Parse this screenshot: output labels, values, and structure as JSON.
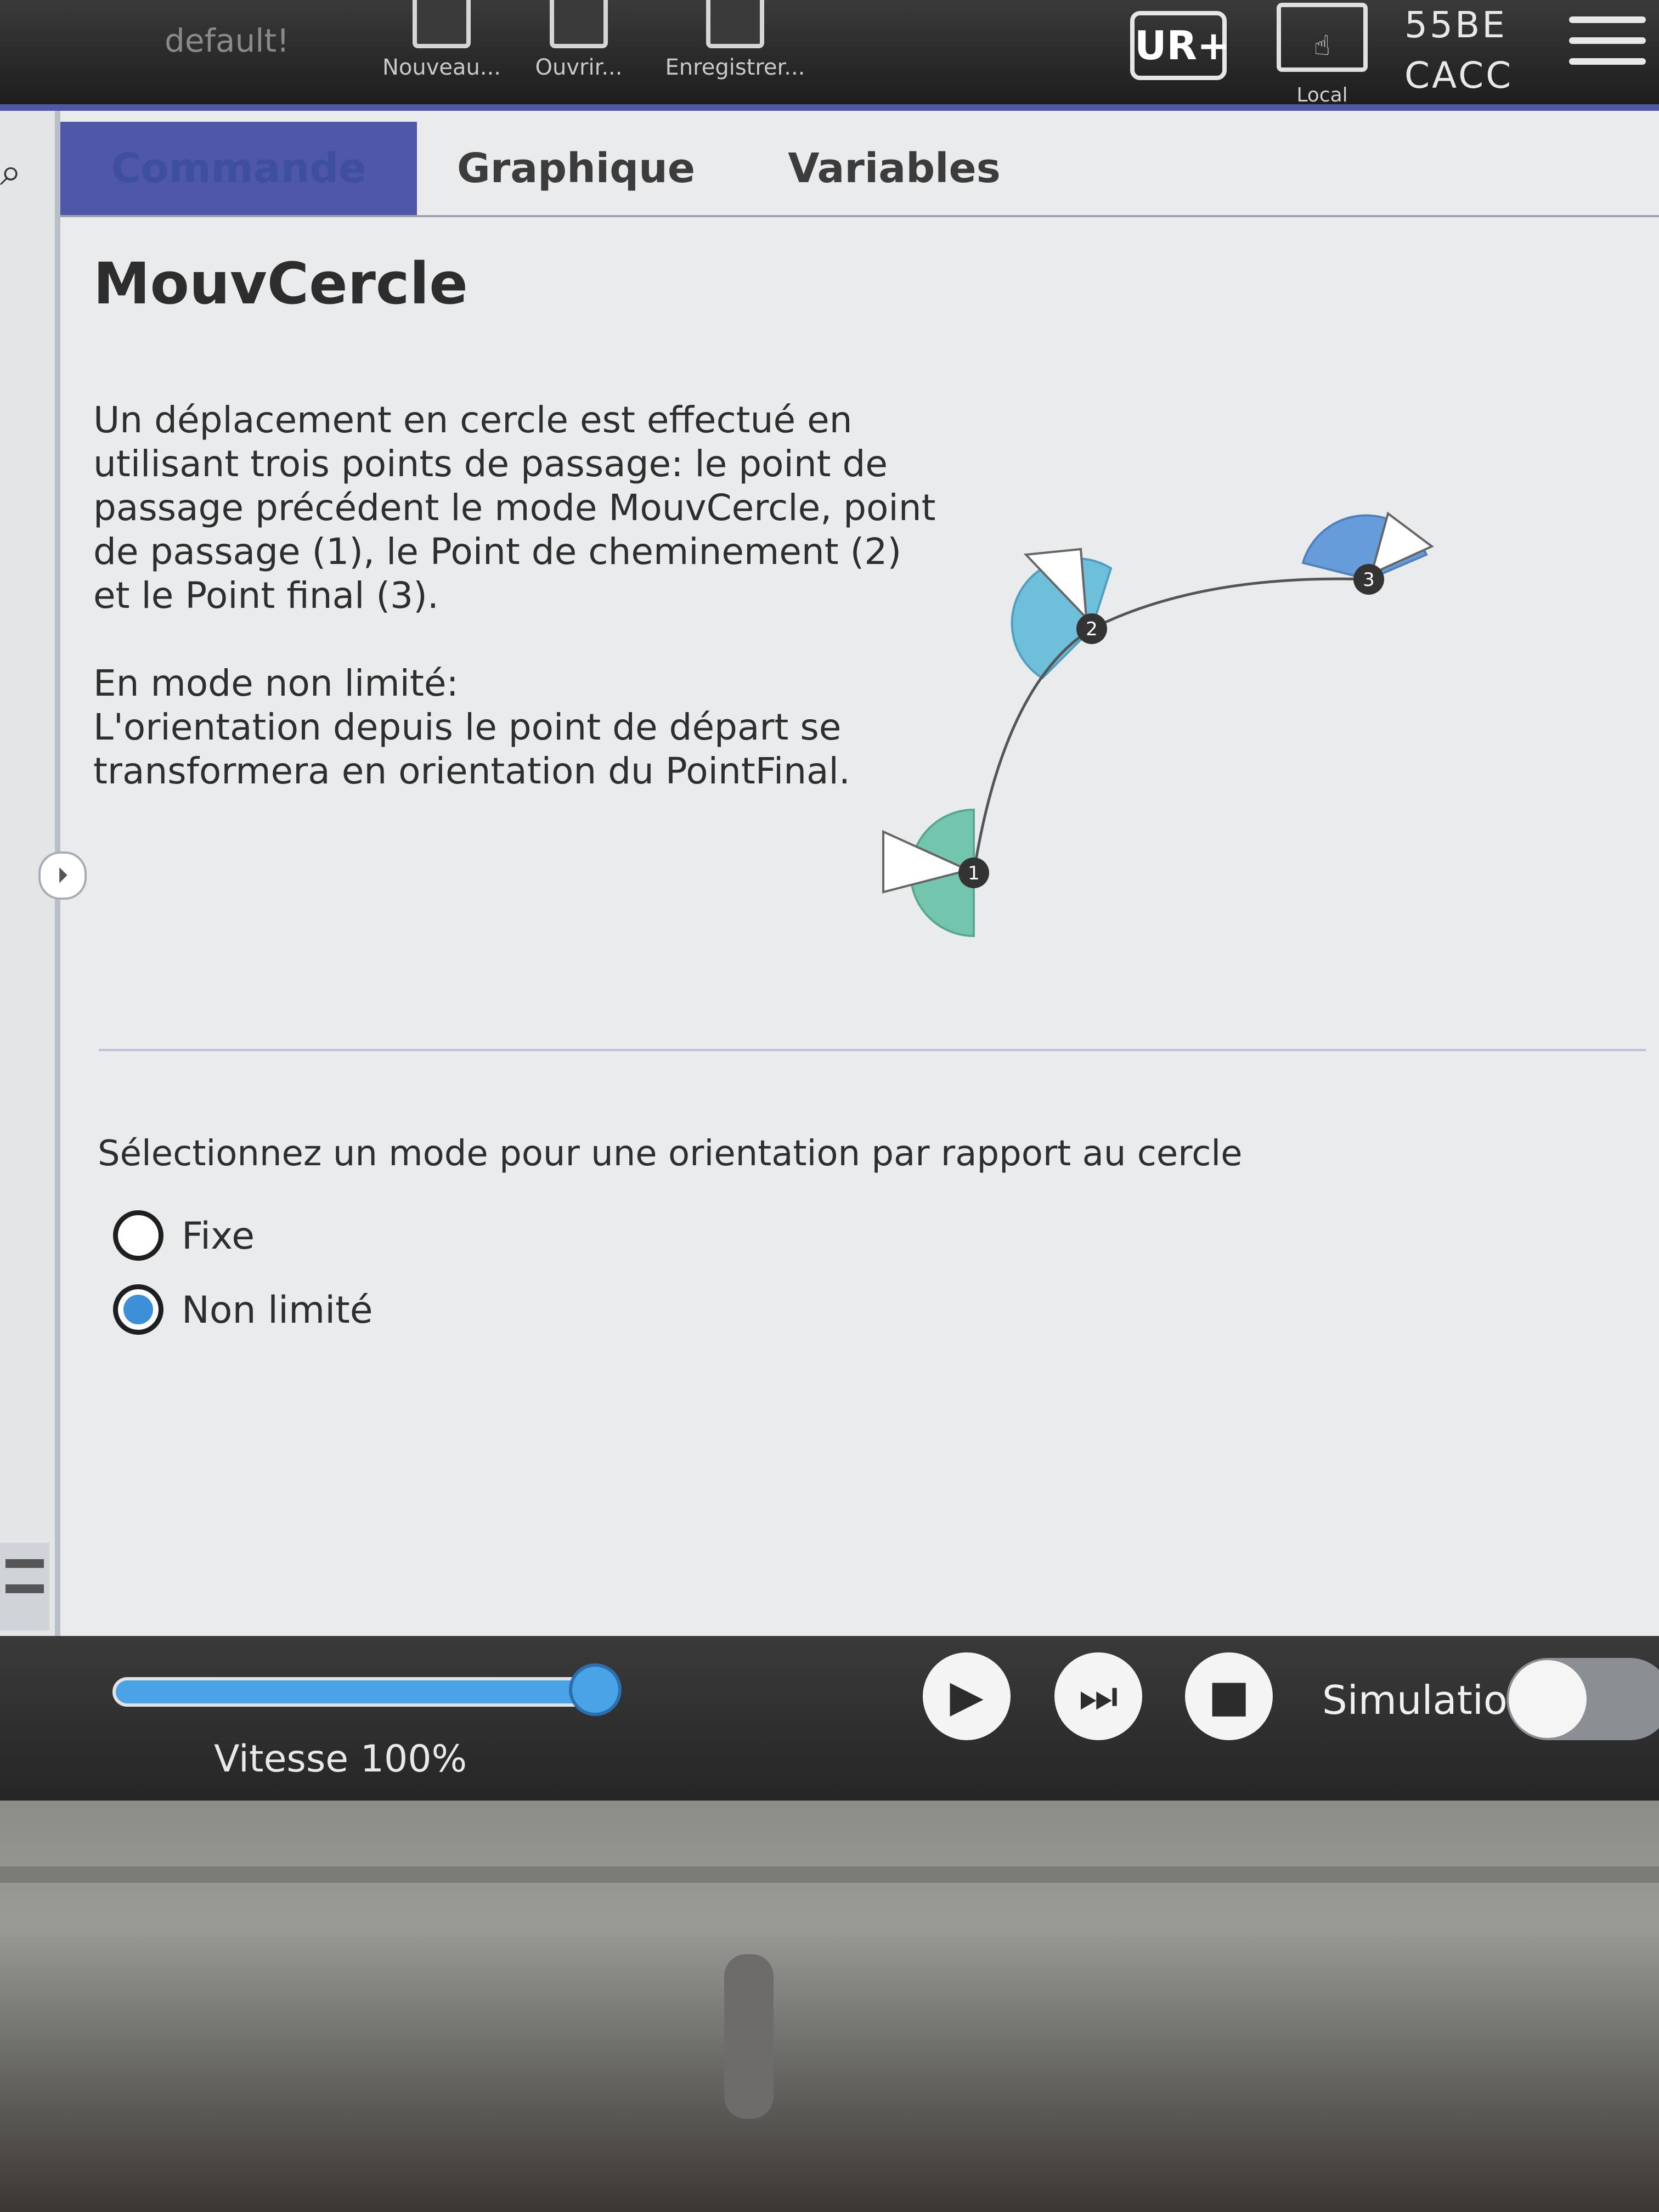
{
  "header": {
    "project_name": "default!",
    "toolbar": {
      "new_label": "Nouveau...",
      "open_label": "Ouvrir...",
      "save_label": "Enregistrer..."
    },
    "local_label": "Local",
    "robot_name_line1": "55BE",
    "robot_name_line2": "CACC",
    "accent_color": "#4e57a8"
  },
  "tabs": [
    {
      "label": "Commande",
      "active": true
    },
    {
      "label": "Graphique",
      "active": false
    },
    {
      "label": "Variables",
      "active": false
    }
  ],
  "node": {
    "title": "MouvCercle",
    "description_1": "Un déplacement en cercle est effectué en utilisant trois points de passage: le point de passage précédent le mode MouvCercle, point de passage (1), le Point de cheminement (2) et le Point final (3).",
    "description_2": "En mode non limité:",
    "description_3": "L'orientation depuis le point de départ se transformera en orientation du PointFinal.",
    "diagram_points": [
      "1",
      "2",
      "3"
    ],
    "diagram_colors": {
      "start_wedge": "#5fbfa4",
      "mid_wedge": "#58b8d8",
      "end_wedge": "#4f8fd6"
    }
  },
  "orientation": {
    "prompt": "Sélectionnez un mode pour une orientation par rapport au cercle",
    "options": [
      {
        "label": "Fixe",
        "selected": false
      },
      {
        "label": "Non limité",
        "selected": true
      }
    ]
  },
  "footer": {
    "speed_label": "Vitesse 100%",
    "speed_fraction": 1.0,
    "play_icon": "play-icon",
    "step_icon": "step-icon",
    "stop_icon": "stop-icon",
    "simulation_label": "Simulation",
    "simulation_on": false
  }
}
